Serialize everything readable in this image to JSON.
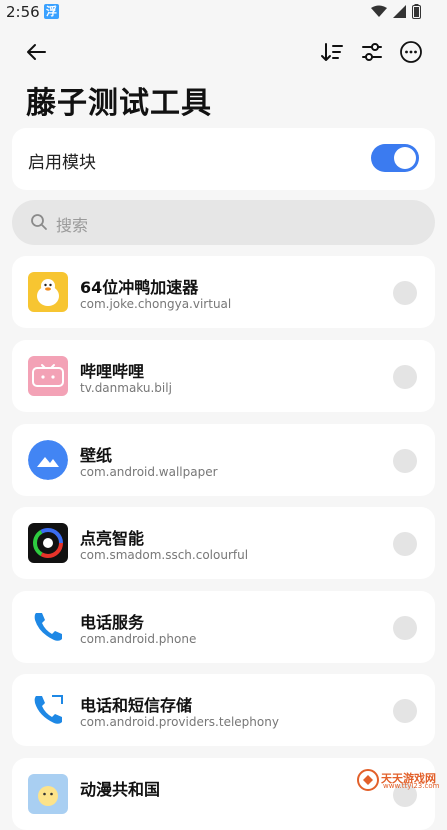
{
  "status_bar": {
    "time": "2:56",
    "app_badge": "浮"
  },
  "title": "藤子测试工具",
  "module": {
    "label": "启用模块",
    "enabled": true
  },
  "search": {
    "placeholder": "搜索"
  },
  "apps": [
    {
      "name": "64位冲鸭加速器",
      "package": "com.joke.chongya.virtual",
      "icon": "duck-icon",
      "checked": false
    },
    {
      "name": "哔哩哔哩",
      "package": "tv.danmaku.bilj",
      "icon": "bilibili-icon",
      "checked": false
    },
    {
      "name": "壁纸",
      "package": "com.android.wallpaper",
      "icon": "wallpaper-icon",
      "checked": false
    },
    {
      "name": "点亮智能",
      "package": "com.smadom.ssch.colourful",
      "icon": "color-wheel-icon",
      "checked": false
    },
    {
      "name": "电话服务",
      "package": "com.android.phone",
      "icon": "phone-icon",
      "checked": false
    },
    {
      "name": "电话和短信存储",
      "package": "com.android.providers.telephony",
      "icon": "phone-storage-icon",
      "checked": false
    },
    {
      "name": "动漫共和国",
      "package": "",
      "icon": "anime-icon",
      "checked": false
    }
  ],
  "watermark": {
    "text": "天天游戏网",
    "sub": "www.ttyl23.com"
  },
  "colors": {
    "accent": "#3b7bf0",
    "card": "#ffffff",
    "background": "#f6f6f6"
  }
}
